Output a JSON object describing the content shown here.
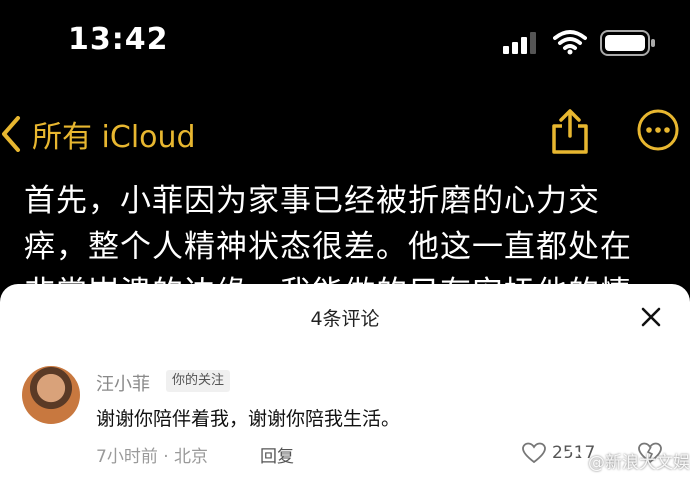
{
  "status": {
    "time": "13:42"
  },
  "nav": {
    "back_label": "所有 iCloud"
  },
  "note": {
    "lines": [
      "首先，小菲因为家事已经被折磨的心力交",
      "瘁，整个人精神状态很差。他这一直都处在",
      "非常崩溃的边缘，我能做的只有安抚他的情"
    ]
  },
  "comments": {
    "title": "4条评论",
    "items": [
      {
        "user": "汪小菲",
        "badge": "你的关注",
        "text": "谢谢你陪伴着我，谢谢你陪我生活。",
        "meta": "7小时前 · 北京",
        "reply_label": "回复",
        "likes": "2517"
      }
    ]
  },
  "watermark": "@新浪大文娱",
  "colors": {
    "accent": "#e8b730",
    "background": "#000000",
    "sheet": "#ffffff"
  }
}
